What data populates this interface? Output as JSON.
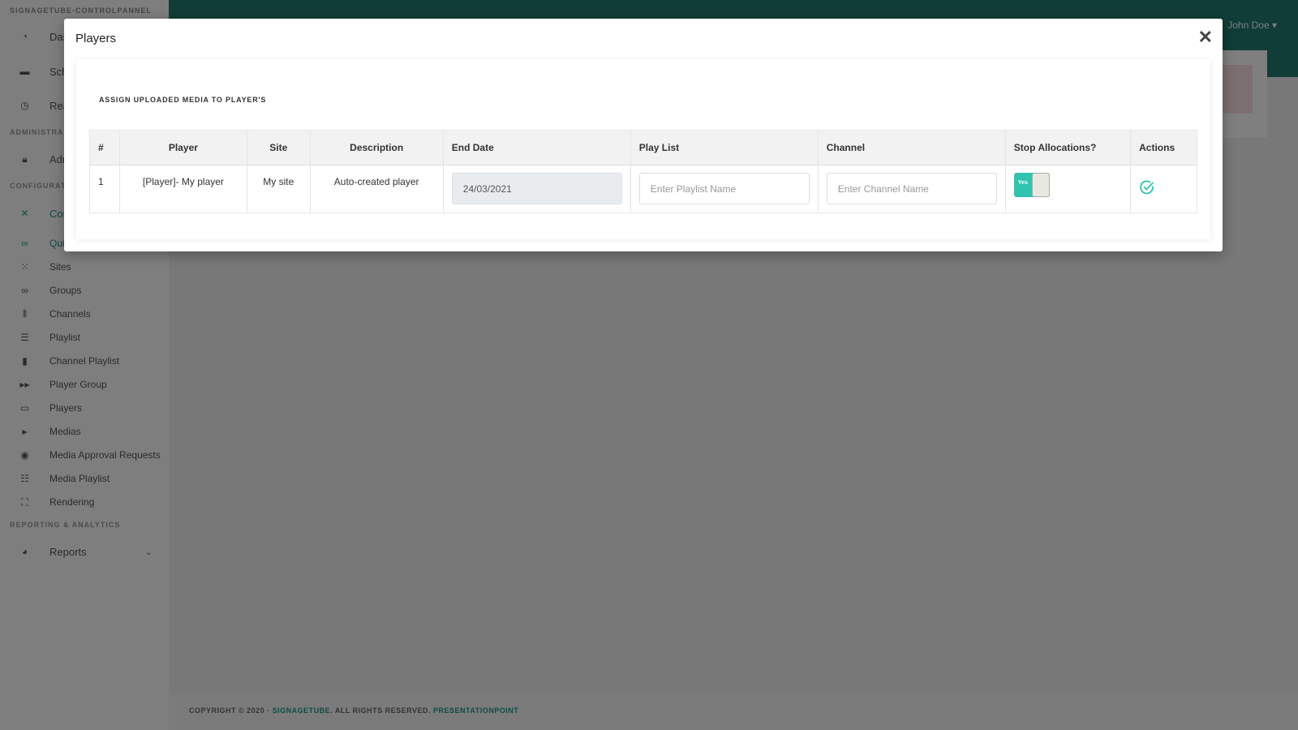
{
  "app": {
    "brand": "SIGNAGETUBE-CONTROLPANNEL"
  },
  "user": {
    "name": "John Doe"
  },
  "sidebar": {
    "top_items": [
      {
        "label": "Das",
        "icon": "dashboard-icon"
      },
      {
        "label": "Sch",
        "icon": "schedule-icon"
      },
      {
        "label": "Rea",
        "icon": "clock-icon"
      }
    ],
    "section_admin": "ADMINISTRA",
    "admin_item": {
      "label": "Adr",
      "icon": "lock-icon"
    },
    "section_config": "CONFIGURAT",
    "config_item": {
      "label": "Con",
      "icon": "tools-icon"
    },
    "items": [
      {
        "label": "Qui",
        "icon": "bike-icon"
      },
      {
        "label": "Sites",
        "icon": "grid-icon"
      },
      {
        "label": "Groups",
        "icon": "groups-icon"
      },
      {
        "label": "Channels",
        "icon": "bars-icon"
      },
      {
        "label": "Playlist",
        "icon": "sliders-icon"
      },
      {
        "label": "Channel Playlist",
        "icon": "film-icon"
      },
      {
        "label": "Player Group",
        "icon": "fast-forward-icon"
      },
      {
        "label": "Players",
        "icon": "monitor-icon"
      },
      {
        "label": "Medias",
        "icon": "play-icon"
      },
      {
        "label": "Media Approval Requests",
        "icon": "eye-icon"
      },
      {
        "label": "Media Playlist",
        "icon": "sliders-icon"
      },
      {
        "label": "Rendering",
        "icon": "expand-icon"
      }
    ],
    "section_reporting": "REPORTING & ANALYTICS",
    "reports_item": {
      "label": "Reports",
      "icon": "pie-chart-icon"
    }
  },
  "footer": {
    "prefix": "COPYRIGHT © 2020 · ",
    "brand": "SIGNAGETUBE",
    "middle": ". ALL RIGHTS RESERVED. ",
    "company": "PRESENTATIONPOINT"
  },
  "modal": {
    "title": "Players",
    "panel_title": "ASSIGN UPLOADED MEDIA TO PLAYER'S",
    "table": {
      "headers": [
        "#",
        "Player",
        "Site",
        "Description",
        "End Date",
        "Play List",
        "Channel",
        "Stop Allocations?",
        "Actions"
      ],
      "rows": [
        {
          "index": "1",
          "player": "[Player]- My player",
          "site": "My site",
          "description": "Auto-created player",
          "end_date": "24/03/2021",
          "playlist_placeholder": "Enter Playlist Name",
          "channel_placeholder": "Enter Channel Name",
          "stop_allocations": "Yes"
        }
      ]
    }
  },
  "colors": {
    "accent": "#1c9a8a",
    "topbar": "#217a6f",
    "toggle_on": "#2ec4b0"
  }
}
